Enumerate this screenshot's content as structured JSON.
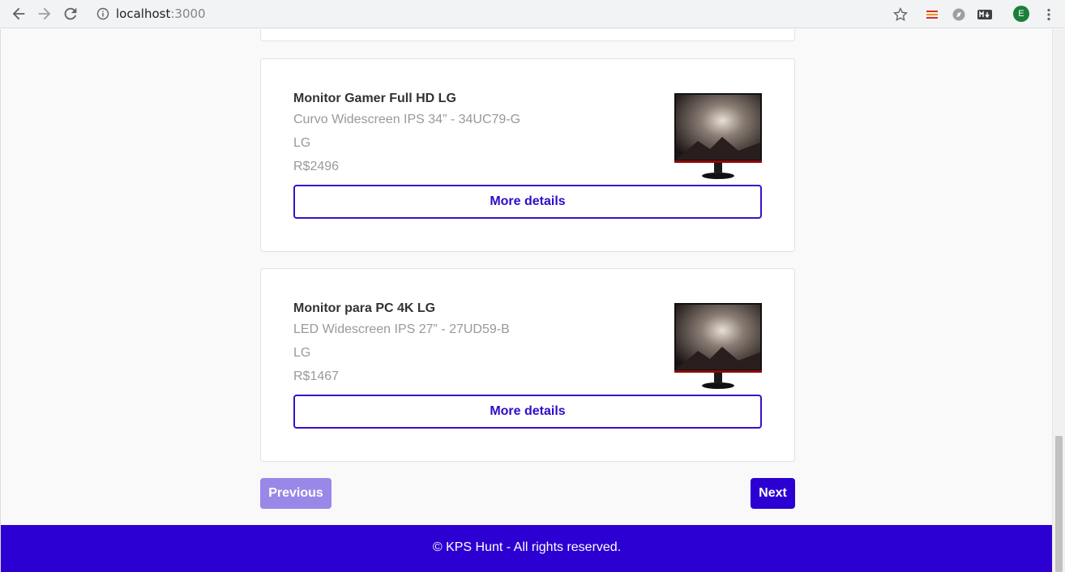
{
  "browser": {
    "url_host": "localhost",
    "url_port": ":3000",
    "profile_initial": "E"
  },
  "products": [
    {
      "title": "Monitor Gamer Full HD LG",
      "description": "Curvo Widescreen IPS 34” - 34UC79-G",
      "brand": "LG",
      "price": "R$2496",
      "button_label": "More details"
    },
    {
      "title": "Monitor para PC 4K LG",
      "description": "LED Widescreen IPS 27” - 27UD59-B",
      "brand": "LG",
      "price": "R$1467",
      "button_label": "More details"
    }
  ],
  "pagination": {
    "previous_label": "Previous",
    "next_label": "Next"
  },
  "footer": {
    "text": "© KPS Hunt - All rights reserved."
  },
  "colors": {
    "accent": "#2c00d2",
    "accent_disabled": "#9b87e8"
  }
}
